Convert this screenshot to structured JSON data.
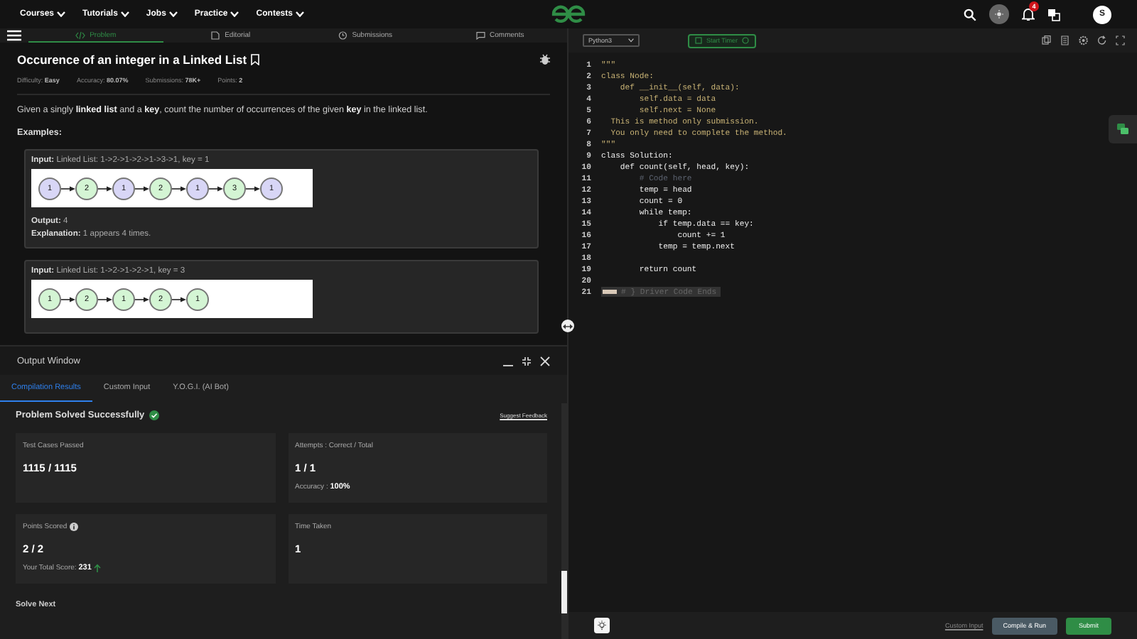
{
  "nav": {
    "menus": [
      "Courses",
      "Tutorials",
      "Jobs",
      "Practice",
      "Contests"
    ],
    "notification_count": "4",
    "avatar_initial": "S"
  },
  "problem_tabs": [
    {
      "label": "Problem",
      "selected": true
    },
    {
      "label": "Editorial",
      "selected": false
    },
    {
      "label": "Submissions",
      "selected": false
    },
    {
      "label": "Comments",
      "selected": false
    }
  ],
  "problem": {
    "title": "Occurence of an integer in a Linked List",
    "meta": [
      {
        "label": "Difficulty:",
        "value": "Easy"
      },
      {
        "label": "Accuracy:",
        "value": "80.07%"
      },
      {
        "label": "Submissions:",
        "value": "78K+"
      },
      {
        "label": "Points:",
        "value": "2"
      }
    ],
    "description": "Given a singly **linked list** and a **key**, count the number of occurrences of the given **key** in the linked list.",
    "examples_heading": "Examples:",
    "examples": [
      {
        "input": "**Input:** Linked List: 1->2->1->2->1->3->1, key = 1",
        "nodes": [
          {
            "value": "1",
            "color": "#d8d6f6"
          },
          {
            "value": "2",
            "color": "#d4f5d4"
          },
          {
            "value": "1",
            "color": "#d8d6f6"
          },
          {
            "value": "2",
            "color": "#d4f5d4"
          },
          {
            "value": "1",
            "color": "#d8d6f6"
          },
          {
            "value": "3",
            "color": "#d4f5d4"
          },
          {
            "value": "1",
            "color": "#d8d6f6"
          }
        ],
        "output": "**Output:** 4",
        "explanation": "**Explanation:** 1 appears 4 times."
      },
      {
        "input": "**Input:** Linked List: 1->2->1->2->1, key = 3",
        "nodes": [
          {
            "value": "1",
            "color": "#d4f5d4"
          },
          {
            "value": "2",
            "color": "#d4f5d4"
          },
          {
            "value": "1",
            "color": "#d4f5d4"
          },
          {
            "value": "2",
            "color": "#d4f5d4"
          },
          {
            "value": "1",
            "color": "#d4f5d4"
          }
        ]
      }
    ]
  },
  "output_window": {
    "title": "Output Window",
    "tabs": [
      {
        "label": "Compilation Results",
        "selected": true
      },
      {
        "label": "Custom Input",
        "selected": false
      },
      {
        "label": "Y.O.G.I. (AI Bot)",
        "selected": false
      }
    ],
    "status": "Problem Solved Successfully",
    "feedback_link": "Suggest Feedback",
    "cards": [
      {
        "kind": "plain",
        "label": "Test Cases Passed",
        "value": "1115 / 1115"
      },
      {
        "kind": "accuracy",
        "label": "Attempts : Correct / Total",
        "value": "1 / 1",
        "note": "Accuracy : **100%**"
      },
      {
        "kind": "score",
        "label": "Points Scored",
        "value": "2 / 2",
        "note": "Your Total Score: **231**"
      },
      {
        "kind": "plain",
        "label": "Time Taken",
        "value": "1"
      }
    ],
    "solve_next": "Solve Next"
  },
  "editor": {
    "language": "Python3",
    "timer_button": "Start Timer",
    "lines": [
      {
        "number": "1",
        "text": "\"\"\"",
        "kind": "docstring"
      },
      {
        "number": "2",
        "text": "class Node:",
        "kind": "docstring"
      },
      {
        "number": "3",
        "text": "    def __init__(self, data):",
        "kind": "docstring"
      },
      {
        "number": "4",
        "text": "        self.data = data",
        "kind": "docstring"
      },
      {
        "number": "5",
        "text": "        self.next = None",
        "kind": "docstring"
      },
      {
        "number": "6",
        "text": "  This is method only submission.",
        "kind": "docstring"
      },
      {
        "number": "7",
        "text": "  You only need to complete the method.",
        "kind": "docstring"
      },
      {
        "number": "8",
        "text": "\"\"\"",
        "kind": "docstring"
      },
      {
        "number": "9",
        "text": "class Solution:",
        "kind": "code"
      },
      {
        "number": "10",
        "text": "    def count(self, head, key):",
        "kind": "code"
      },
      {
        "number": "11",
        "text": "        # Code here",
        "kind": "comment"
      },
      {
        "number": "12",
        "text": "        temp = head",
        "kind": "code"
      },
      {
        "number": "13",
        "text": "        count = 0",
        "kind": "code"
      },
      {
        "number": "14",
        "text": "        while temp:",
        "kind": "code"
      },
      {
        "number": "15",
        "text": "            if temp.data == key:",
        "kind": "code"
      },
      {
        "number": "16",
        "text": "                count += 1",
        "kind": "code"
      },
      {
        "number": "17",
        "text": "            temp = temp.next",
        "kind": "code"
      },
      {
        "number": "18",
        "kind": "code"
      },
      {
        "number": "19",
        "text": "        return count",
        "kind": "code"
      },
      {
        "number": "20",
        "kind": "code"
      },
      {
        "number": "21",
        "text": "# } Driver Code Ends",
        "kind": "folded"
      }
    ],
    "custom_input": "Custom Input",
    "compile_button": "Compile & Run",
    "submit_button": "Submit"
  }
}
